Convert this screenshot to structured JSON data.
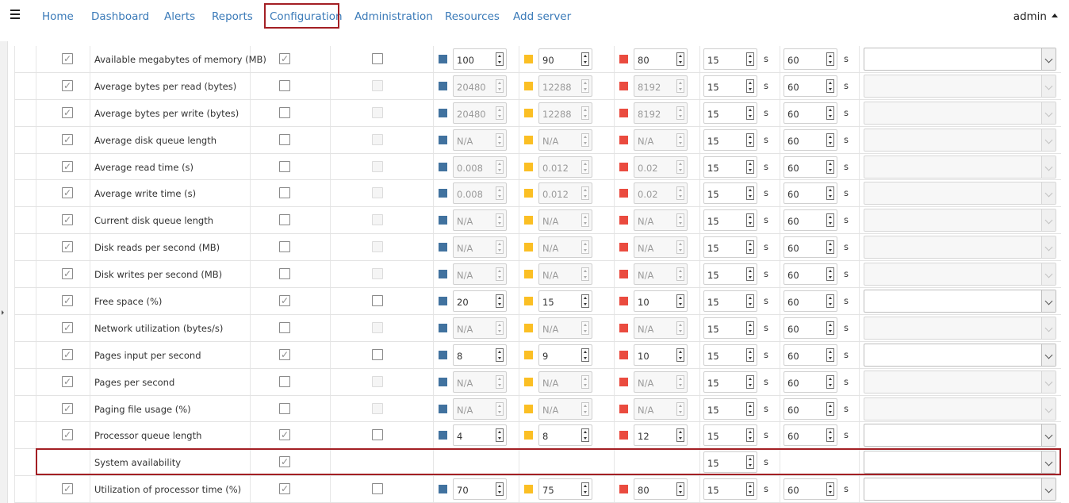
{
  "nav": {
    "items": [
      "Home",
      "Dashboard",
      "Alerts",
      "Reports",
      "Configuration",
      "Administration",
      "Resources",
      "Add server"
    ],
    "active": "Configuration",
    "user": "admin"
  },
  "rows": [
    {
      "name": "Available megabytes of memory (MB)",
      "enabled": true,
      "col3": true,
      "col4_disabled": false,
      "green": "100",
      "yellow": "90",
      "red": "80",
      "thr_disabled": false,
      "s1": "15",
      "s2": "60",
      "dd_disabled": false
    },
    {
      "name": "Average bytes per read (bytes)",
      "enabled": true,
      "col3": false,
      "col4_disabled": true,
      "green": "20480",
      "yellow": "12288",
      "red": "8192",
      "thr_disabled": true,
      "s1": "15",
      "s2": "60",
      "dd_disabled": true
    },
    {
      "name": "Average bytes per write (bytes)",
      "enabled": true,
      "col3": false,
      "col4_disabled": true,
      "green": "20480",
      "yellow": "12288",
      "red": "8192",
      "thr_disabled": true,
      "s1": "15",
      "s2": "60",
      "dd_disabled": true
    },
    {
      "name": "Average disk queue length",
      "enabled": true,
      "col3": false,
      "col4_disabled": true,
      "green": "N/A",
      "yellow": "N/A",
      "red": "N/A",
      "thr_disabled": true,
      "s1": "15",
      "s2": "60",
      "dd_disabled": true
    },
    {
      "name": "Average read time (s)",
      "enabled": true,
      "col3": false,
      "col4_disabled": true,
      "green": "0.008",
      "yellow": "0.012",
      "red": "0.02",
      "thr_disabled": true,
      "s1": "15",
      "s2": "60",
      "dd_disabled": true
    },
    {
      "name": "Average write time (s)",
      "enabled": true,
      "col3": false,
      "col4_disabled": true,
      "green": "0.008",
      "yellow": "0.012",
      "red": "0.02",
      "thr_disabled": true,
      "s1": "15",
      "s2": "60",
      "dd_disabled": true
    },
    {
      "name": "Current disk queue length",
      "enabled": true,
      "col3": false,
      "col4_disabled": true,
      "green": "N/A",
      "yellow": "N/A",
      "red": "N/A",
      "thr_disabled": true,
      "s1": "15",
      "s2": "60",
      "dd_disabled": true
    },
    {
      "name": "Disk reads per second (MB)",
      "enabled": true,
      "col3": false,
      "col4_disabled": true,
      "green": "N/A",
      "yellow": "N/A",
      "red": "N/A",
      "thr_disabled": true,
      "s1": "15",
      "s2": "60",
      "dd_disabled": true
    },
    {
      "name": "Disk writes per second (MB)",
      "enabled": true,
      "col3": false,
      "col4_disabled": true,
      "green": "N/A",
      "yellow": "N/A",
      "red": "N/A",
      "thr_disabled": true,
      "s1": "15",
      "s2": "60",
      "dd_disabled": true
    },
    {
      "name": "Free space (%)",
      "enabled": true,
      "col3": true,
      "col4_disabled": false,
      "green": "20",
      "yellow": "15",
      "red": "10",
      "thr_disabled": false,
      "s1": "15",
      "s2": "60",
      "dd_disabled": false
    },
    {
      "name": "Network utilization (bytes/s)",
      "enabled": true,
      "col3": false,
      "col4_disabled": true,
      "green": "N/A",
      "yellow": "N/A",
      "red": "N/A",
      "thr_disabled": true,
      "s1": "15",
      "s2": "60",
      "dd_disabled": true
    },
    {
      "name": "Pages input per second",
      "enabled": true,
      "col3": true,
      "col4_disabled": false,
      "green": "8",
      "yellow": "9",
      "red": "10",
      "thr_disabled": false,
      "s1": "15",
      "s2": "60",
      "dd_disabled": false
    },
    {
      "name": "Pages per second",
      "enabled": true,
      "col3": false,
      "col4_disabled": true,
      "green": "N/A",
      "yellow": "N/A",
      "red": "N/A",
      "thr_disabled": true,
      "s1": "15",
      "s2": "60",
      "dd_disabled": true
    },
    {
      "name": "Paging file usage (%)",
      "enabled": true,
      "col3": false,
      "col4_disabled": true,
      "green": "N/A",
      "yellow": "N/A",
      "red": "N/A",
      "thr_disabled": true,
      "s1": "15",
      "s2": "60",
      "dd_disabled": true
    },
    {
      "name": "Processor queue length",
      "enabled": true,
      "col3": true,
      "col4_disabled": false,
      "green": "4",
      "yellow": "8",
      "red": "12",
      "thr_disabled": false,
      "s1": "15",
      "s2": "60",
      "dd_disabled": false
    },
    {
      "name": "System availability",
      "special": true,
      "col3": true,
      "s1": "15",
      "dd_disabled": false
    },
    {
      "name": "Utilization of processor time (%)",
      "enabled": true,
      "col3": true,
      "col4_disabled": false,
      "green": "70",
      "yellow": "75",
      "red": "80",
      "thr_disabled": false,
      "s1": "15",
      "s2": "60",
      "dd_disabled": false
    }
  ],
  "unit_seconds": "s",
  "check_glyph": "✓",
  "colors": {
    "green_swatch": "#41729f",
    "yellow_swatch": "#fbbf24",
    "red_swatch": "#ea4b3f",
    "highlight": "#a31f24",
    "link": "#3a7ab8"
  }
}
